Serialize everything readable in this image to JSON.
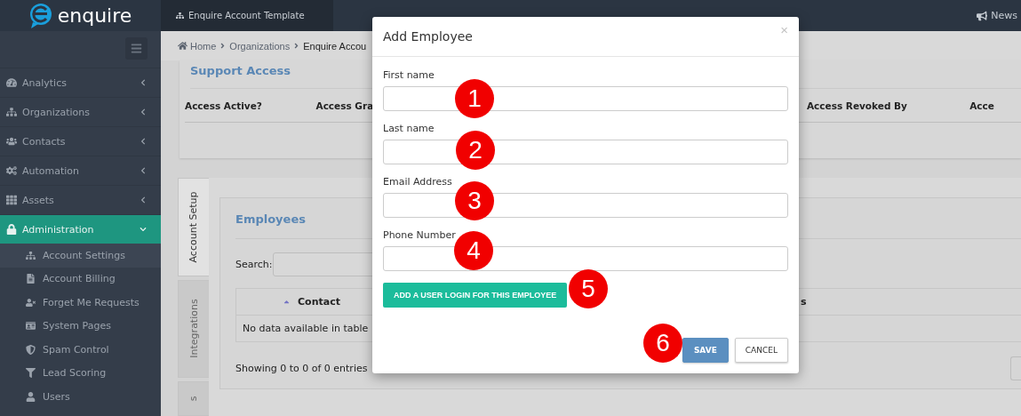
{
  "topbar": {
    "logo": "enquire",
    "tab": "Enquire Account Template",
    "news": "News"
  },
  "sidebar": {
    "items": [
      {
        "label": "Analytics",
        "expanded": false
      },
      {
        "label": "Organizations",
        "expanded": false
      },
      {
        "label": "Contacts",
        "expanded": false
      },
      {
        "label": "Automation",
        "expanded": false
      },
      {
        "label": "Assets",
        "expanded": false
      },
      {
        "label": "Administration",
        "expanded": true,
        "children": [
          {
            "label": "Account Settings",
            "selected": true
          },
          {
            "label": "Account Billing",
            "selected": false
          },
          {
            "label": "Forget Me Requests",
            "selected": false
          },
          {
            "label": "System Pages",
            "selected": false
          },
          {
            "label": "Spam Control",
            "selected": false
          },
          {
            "label": "Lead Scoring",
            "selected": false
          },
          {
            "label": "Users",
            "selected": false
          }
        ]
      }
    ]
  },
  "breadcrumb": [
    "Home",
    "Organizations",
    "Enquire Accou"
  ],
  "support_access": {
    "title": "Support Access",
    "columns": [
      "Access Active?",
      "Access Gra",
      "Access Revoked By",
      "Acce"
    ]
  },
  "vertical_tabs": [
    {
      "label": "Account Setup",
      "selected": true
    },
    {
      "label": "Integrations",
      "selected": false
    },
    {
      "label": "s",
      "selected": false
    }
  ],
  "employees": {
    "title": "Employees",
    "search_label": "Search:",
    "columns": [
      "Contact",
      "s"
    ],
    "empty": "No data available in table",
    "info": "Showing 0 to 0 of 0 entries"
  },
  "modal": {
    "title": "Add Employee",
    "close": "×",
    "fields": [
      {
        "label": "First name"
      },
      {
        "label": "Last name"
      },
      {
        "label": "Email Address"
      },
      {
        "label": "Phone Number"
      }
    ],
    "login_button": "ADD A USER LOGIN FOR THIS EMPLOYEE",
    "save": "SAVE",
    "cancel": "CANCEL"
  },
  "annotations": [
    {
      "label": "1"
    },
    {
      "label": "2"
    },
    {
      "label": "3"
    },
    {
      "label": "4"
    },
    {
      "label": "5"
    },
    {
      "label": "6"
    }
  ]
}
